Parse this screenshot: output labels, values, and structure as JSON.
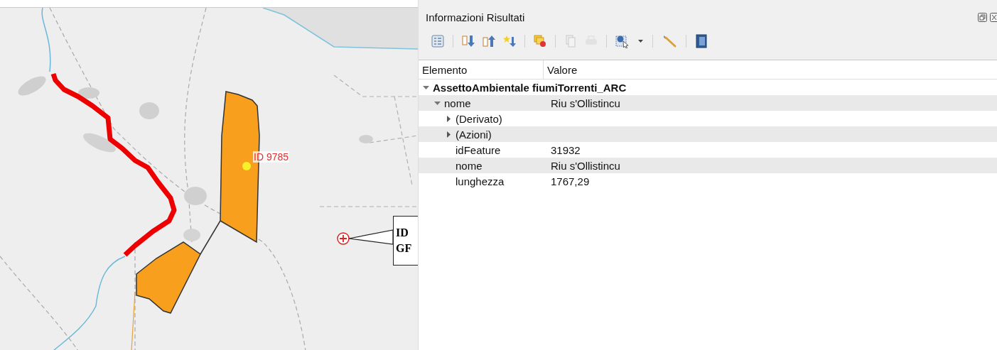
{
  "map": {
    "feature_label": "ID 9785",
    "callout_lines": [
      "ID",
      "GF"
    ]
  },
  "panel": {
    "title": "Informazioni Risultati",
    "toolbar": [
      {
        "disabled": false
      },
      {
        "disabled": false
      },
      {
        "disabled": false
      },
      {
        "disabled": false
      },
      {
        "disabled": false
      },
      {
        "disabled": true
      },
      {
        "disabled": true
      },
      {
        "disabled": false
      },
      {
        "disabled": false
      },
      {
        "disabled": false
      },
      {
        "disabled": false
      }
    ],
    "columns": [
      "Elemento",
      "Valore"
    ],
    "tree": [
      {
        "label": "AssettoAmbientale fiumiTorrenti_ARC",
        "expanded": true,
        "children": [
          {
            "label": "nome",
            "value": "Riu s'Ollistincu",
            "expanded": true,
            "children": [
              {
                "label": "(Derivato)",
                "expanded": false
              },
              {
                "label": "(Azioni)",
                "expanded": false
              },
              {
                "label": "idFeature",
                "value": "31932"
              },
              {
                "label": "nome",
                "value": "Riu s'Ollistincu"
              },
              {
                "label": "lunghezza",
                "value": "1767,29"
              }
            ]
          }
        ]
      }
    ]
  }
}
